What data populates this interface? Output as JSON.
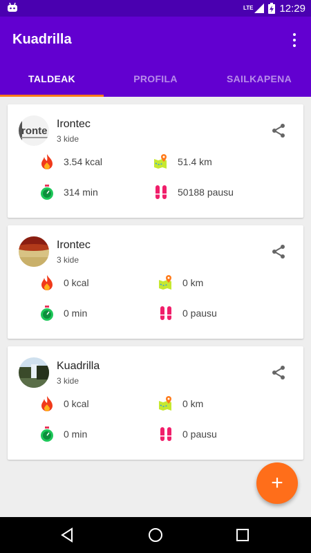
{
  "status_bar": {
    "network": "LTE",
    "time": "12:29"
  },
  "app_bar": {
    "title": "Kuadrilla",
    "menu_icon": "more-vert-icon"
  },
  "tabs": [
    {
      "label": "TALDEAK",
      "active": true
    },
    {
      "label": "PROFILA",
      "active": false
    },
    {
      "label": "SAILKAPENA",
      "active": false
    }
  ],
  "teams": [
    {
      "name": "Irontec",
      "members": "3 kide",
      "kcal": "3.54 kcal",
      "km": "51.4 km",
      "min": "314 min",
      "steps": "50188 pausu"
    },
    {
      "name": "Irontec",
      "members": "3 kide",
      "kcal": "0 kcal",
      "km": "0 km",
      "min": "0 min",
      "steps": "0 pausu"
    },
    {
      "name": "Kuadrilla",
      "members": "3 kide",
      "kcal": "0 kcal",
      "km": "0 km",
      "min": "0 min",
      "steps": "0 pausu"
    }
  ],
  "fab": {
    "label": "+",
    "icon": "add-icon"
  },
  "colors": {
    "status_bar": "#4a00b0",
    "app_bar": "#6200d0",
    "accent": "#ff6e1a",
    "background": "#eeeeee"
  }
}
